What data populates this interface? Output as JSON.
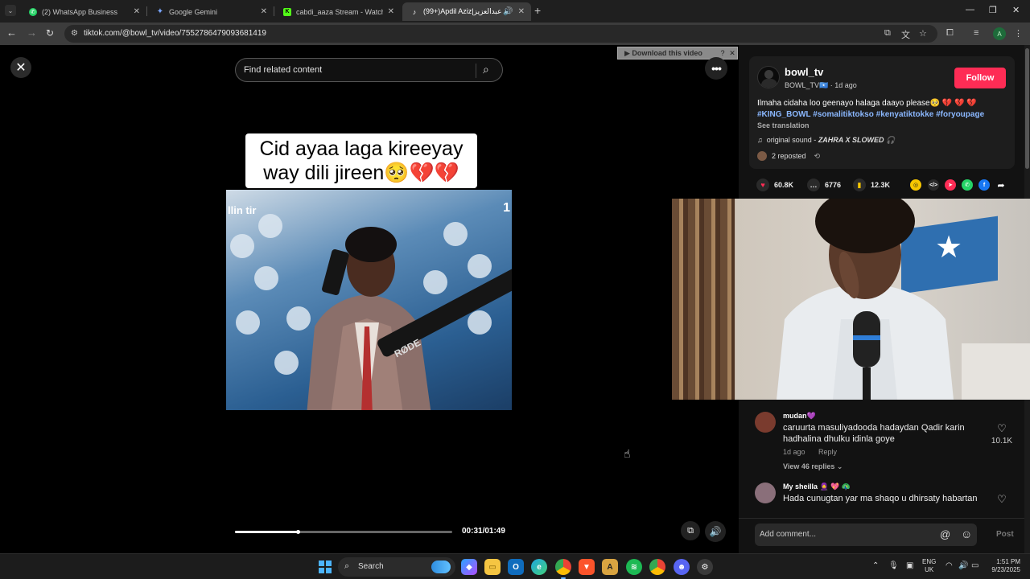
{
  "browser": {
    "tabs": [
      {
        "title": "(2) WhatsApp Business",
        "favicon_color": "#25d366"
      },
      {
        "title": "Google Gemini",
        "favicon_color": "#7aa6ff"
      },
      {
        "title": "cabdi_aaza Stream - Watch Live",
        "favicon_color": "#53fc18"
      },
      {
        "title": "(99+)Apdil Aziz|عبدالعزيز (",
        "favicon_color": "#ffffff"
      }
    ],
    "new_tab_glyph": "+",
    "url": "tiktok.com/@bowl_tv/video/7552786479093681419",
    "profile_initial": "A"
  },
  "search": {
    "placeholder": "Find related content"
  },
  "video": {
    "caption": "Cid ayaa laga kireeyay way dili jireen🥺💔💔",
    "frame_text_left": "llin tir",
    "frame_text_right": "1",
    "mic_brand": "RØDE",
    "progress": 0.29,
    "time": "00:31/01:49"
  },
  "download_bar": {
    "label": "▶ Download this video",
    "help": "?",
    "close": "✕"
  },
  "author": {
    "username": "bowl_tv",
    "subline": "BOWL_TV🇸🇴 · 1d ago",
    "follow_label": "Follow"
  },
  "post": {
    "description": "Ilmaha cidaha loo geenayo halaga daayo please🥺 💔 💔 💔",
    "tags": "#KING_BOWL #somalitiktokso #kenyatiktokke #foryoupage",
    "see_translation": "See translation",
    "sound_prefix": "original sound - ",
    "sound_name": "ZAHRA X SLOWED 🎧",
    "reposted": "2 reposted"
  },
  "actions": {
    "likes": "60.8K",
    "comments": "6776",
    "saves": "12.3K"
  },
  "comments": [
    {
      "name": "mudan💜",
      "text": "caruurta masuliyadooda hadaydan Qadir karin hadhalina dhulku idinla goye",
      "time": "1d ago",
      "reply": "Reply",
      "view_replies": "View 46 replies ⌄",
      "likes": "10.1K",
      "avatar_color": "#7a3b2e"
    },
    {
      "name": "My sheilla 🧕 💖 🦚",
      "text": "Hada cunugtan yar ma shaqo u dhirsaty habartan",
      "avatar_color": "#8a6f7a"
    }
  ],
  "comment_bar": {
    "placeholder": "Add comment...",
    "post_label": "Post"
  },
  "taskbar": {
    "search_label": "Search",
    "lang_line1": "ENG",
    "lang_line2": "UK",
    "time": "1:51 PM",
    "date": "9/23/2025"
  }
}
